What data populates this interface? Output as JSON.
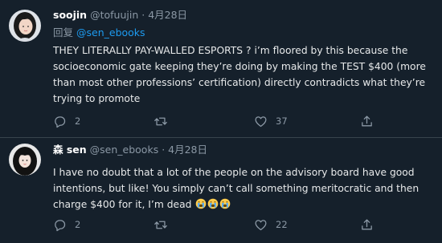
{
  "tweets": [
    {
      "author_name": "soojin",
      "handle": "@tofuujin",
      "separator": "·",
      "date": "4月28日",
      "reply_prefix": "回复",
      "reply_to": "@sen_ebooks",
      "text": "THEY LITERALLY PAY-WALLED ESPORTS ? i’m floored by this because the socioeconomic gate keeping they’re doing by making the TEST $400 (more than most other professions’ certification) directly contradicts what they’re trying to promote",
      "reply_count": "2",
      "retweet_count": "",
      "like_count": "37"
    },
    {
      "author_name": "森 sen",
      "handle": "@sen_ebooks",
      "separator": "·",
      "date": "4月28日",
      "text": "I have no doubt that a lot of the people on the advisory board have good intentions, but like! You simply can’t call something meritocratic and then charge $400 for it, I’m dead",
      "emoji_count": 3,
      "reply_count": "2",
      "retweet_count": "",
      "like_count": "22"
    }
  ],
  "icons": {
    "reply": "reply-icon",
    "retweet": "retweet-icon",
    "like": "heart-icon",
    "share": "share-icon",
    "emoji": "loudly-crying-face-emoji"
  },
  "colors": {
    "background": "#15202b",
    "divider": "#38444d",
    "link": "#1d9bf0",
    "muted": "#8b98a5",
    "text": "#e7e9ea"
  }
}
